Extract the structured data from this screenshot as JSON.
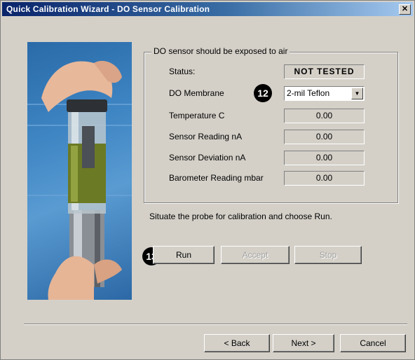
{
  "window": {
    "title": "Quick Calibration Wizard - DO Sensor Calibration",
    "close_glyph": "✕"
  },
  "group": {
    "title": "DO sensor should be exposed to air",
    "status_label": "Status:",
    "status_value": "NOT TESTED",
    "membrane_label": "DO Membrane",
    "membrane_value": "2-mil Teflon",
    "rows": [
      {
        "label": "Temperature C",
        "value": "0.00"
      },
      {
        "label": "Sensor Reading nA",
        "value": "0.00"
      },
      {
        "label": "Sensor Deviation nA",
        "value": "0.00"
      },
      {
        "label": "Barometer Reading mbar",
        "value": "0.00"
      }
    ]
  },
  "instruction": "Situate the probe for calibration and choose Run.",
  "callouts": {
    "membrane": "12",
    "run": "13"
  },
  "actions": {
    "run": "Run",
    "accept": "Accept",
    "stop": "Stop"
  },
  "nav": {
    "back": "< Back",
    "next": "Next >",
    "cancel": "Cancel"
  },
  "icons": {
    "close": "close-icon",
    "dropdown": "chevron-down-icon"
  },
  "colors": {
    "title_bar": "#0a246a",
    "dialog": "#d4d0c8",
    "photo_bg": "#3f86c4"
  }
}
